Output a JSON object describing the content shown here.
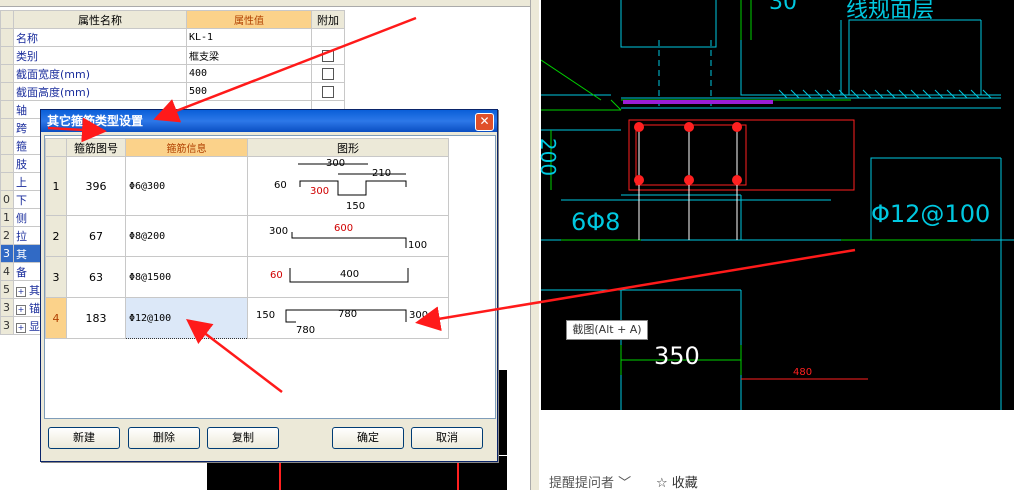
{
  "property_panel": {
    "col_name": "属性名称",
    "col_value": "属性值",
    "col_extra": "附加",
    "rows": [
      {
        "num": "",
        "name": "名称",
        "value": "KL-1",
        "check": false
      },
      {
        "num": "",
        "name": "类别",
        "value": "框支梁",
        "check": true
      },
      {
        "num": "",
        "name": "截面宽度(mm)",
        "value": "400",
        "check": true
      },
      {
        "num": "",
        "name": "截面高度(mm)",
        "value": "500",
        "check": true
      },
      {
        "num": "",
        "name": "轴",
        "value": "",
        "check": false
      },
      {
        "num": "",
        "name": "跨",
        "value": "",
        "check": false
      },
      {
        "num": "",
        "name": "箍",
        "value": "",
        "check": false
      },
      {
        "num": "",
        "name": "肢",
        "value": "",
        "check": false
      },
      {
        "num": "",
        "name": "上",
        "value": "",
        "check": false
      },
      {
        "num": "0",
        "name": "下",
        "value": "",
        "check": false
      },
      {
        "num": "1",
        "name": "侧",
        "value": "",
        "check": false
      },
      {
        "num": "2",
        "name": "拉",
        "value": "",
        "check": false
      },
      {
        "num": "3",
        "name": "其",
        "value": "",
        "check": false
      },
      {
        "num": "4",
        "name": "备",
        "value": "",
        "check": false
      },
      {
        "num": "5",
        "name": "其",
        "value": "",
        "check": false
      },
      {
        "num": "3",
        "name": "锚",
        "value": "",
        "check": false
      },
      {
        "num": "3",
        "name": "显",
        "value": "",
        "check": false
      }
    ]
  },
  "dialog": {
    "title": "其它箍筋类型设置",
    "close": "✕",
    "headers": {
      "fig": "箍筋图号",
      "info": "箍筋信息",
      "shape": "图形"
    },
    "rows": [
      {
        "n": "1",
        "fig": "396",
        "info": "Φ6@300"
      },
      {
        "n": "2",
        "fig": "67",
        "info": "Φ8@200"
      },
      {
        "n": "3",
        "fig": "63",
        "info": "Φ8@1500"
      },
      {
        "n": "4",
        "fig": "183",
        "info": "Φ12@100"
      }
    ],
    "shape_labels": {
      "r1": {
        "a": "300",
        "b": "210",
        "c": "60",
        "d": "300",
        "e": "150"
      },
      "r2": {
        "a": "300",
        "b": "600",
        "c": "100"
      },
      "r3": {
        "a": "60",
        "b": "400"
      },
      "r4": {
        "a": "150",
        "b": "780",
        "c": "300",
        "d": "780"
      }
    },
    "buttons": {
      "new": "新建",
      "delete": "删除",
      "copy": "复制",
      "ok": "确定",
      "cancel": "取消"
    }
  },
  "cad": {
    "text_top": "线规面层",
    "text_top_left": "30",
    "dim_vertical": "200",
    "rebar_left": "6Φ8",
    "rebar_right": "Φ12@100",
    "dim_bottom": "350",
    "dim_small": "480"
  },
  "tooltip": "截图(Alt + A)",
  "footer": {
    "remind": "提醒提问者",
    "favorite": "收藏"
  },
  "colors": {
    "arrow": "#ff1a1a",
    "cad_cyan": "#00c8e0",
    "cad_green": "#00d200",
    "cad_red": "#ff2020"
  }
}
